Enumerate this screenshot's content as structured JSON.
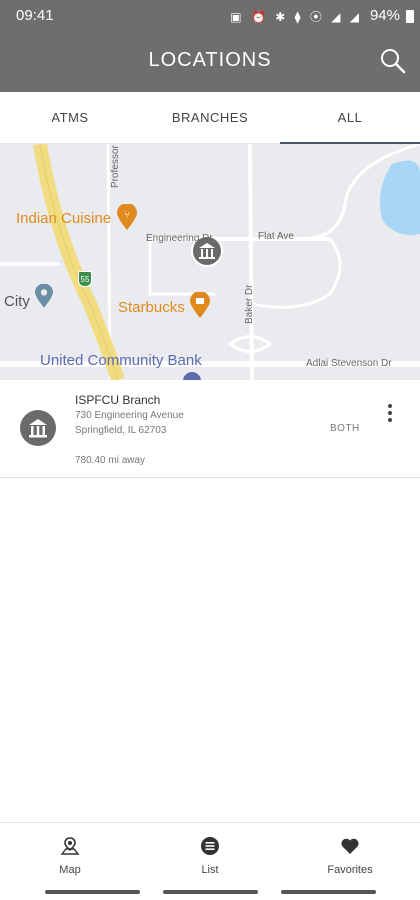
{
  "status_bar": {
    "time": "09:41",
    "icons": [
      "notification-icon",
      "alarm-icon",
      "bluetooth-icon",
      "vibrate-icon",
      "location-icon",
      "wifi-icon",
      "signal-icon"
    ],
    "battery": "94%"
  },
  "header": {
    "title": "LOCATIONS",
    "search_icon": "search-icon"
  },
  "tabs": [
    {
      "label": "ATMS",
      "active": false
    },
    {
      "label": "BRANCHES",
      "active": false
    },
    {
      "label": "ALL",
      "active": true
    }
  ],
  "map": {
    "labels": {
      "indian_cuisine": "Indian Cuisine",
      "starbucks": "Starbucks",
      "united_community_bank": "United Community Bank",
      "city": "City",
      "engineering_dr": "Engineering Dr",
      "flat_ave": "Flat Ave",
      "baker_dr": "Baker Dr",
      "adlai_stevenson_dr": "Adlai Stevenson Dr",
      "professor": "Professor",
      "highway_shield": "55"
    }
  },
  "location": {
    "name": "ISPFCU Branch",
    "address_line1": "730 Engineering Avenue",
    "address_line2": "Springfield, IL 62703",
    "distance": "780.40 mi away",
    "type": "BOTH"
  },
  "bottom_nav": [
    {
      "label": "Map",
      "icon": "map-pin-icon"
    },
    {
      "label": "List",
      "icon": "list-icon"
    },
    {
      "label": "Favorites",
      "icon": "heart-icon"
    }
  ],
  "colors": {
    "header_bg": "#6e6e6e",
    "poi_orange": "#e08a1e",
    "poi_blue": "#5a6bb0",
    "road_yellow": "#f2dc82"
  }
}
